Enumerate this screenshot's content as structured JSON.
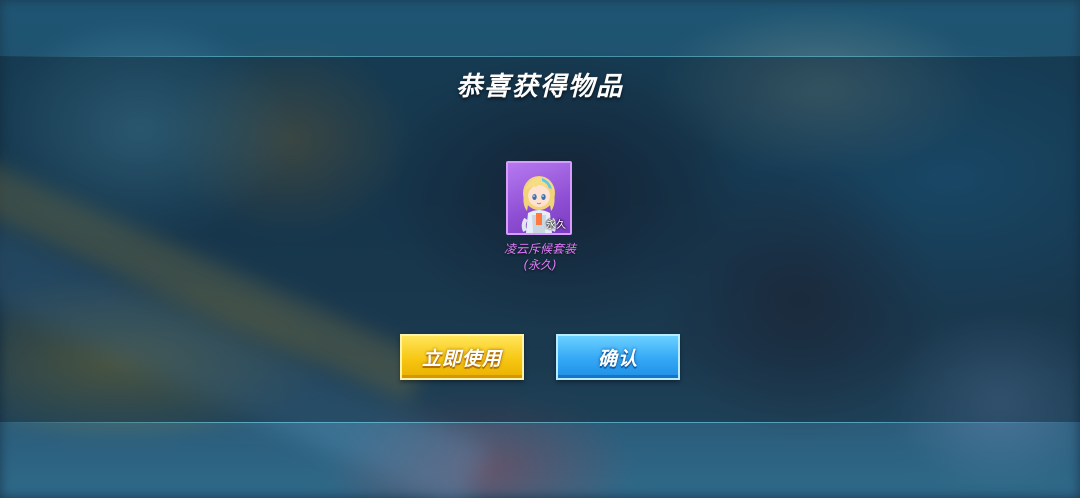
{
  "dialog": {
    "title": "恭喜获得物品"
  },
  "reward": {
    "icon": "character-costume-icon",
    "badge": "永久",
    "name_line1": "凌云斥候套装",
    "name_line2": "(永久)",
    "rarity_color": "#e67bff"
  },
  "buttons": {
    "use_now": "立即使用",
    "confirm": "确认"
  },
  "colors": {
    "use_button": "#f7c712",
    "confirm_button": "#34a8f5",
    "card_background": "#9b5ae0"
  }
}
